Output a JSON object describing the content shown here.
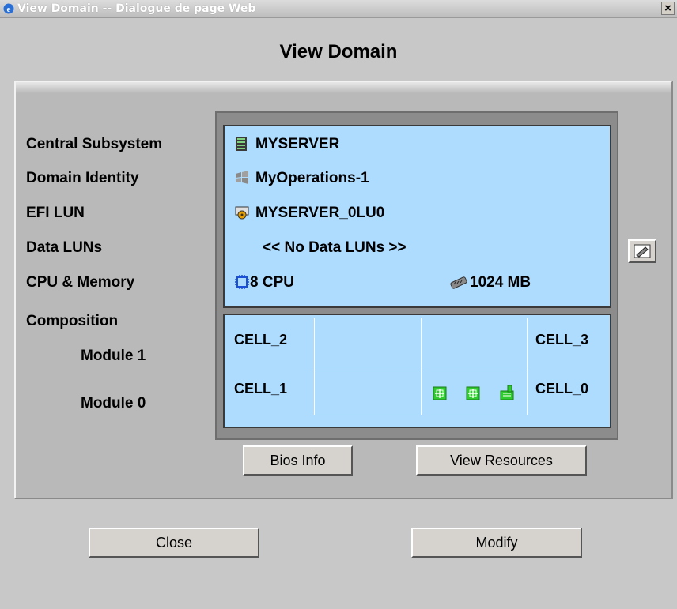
{
  "window": {
    "title": "View Domain -- Dialogue de page Web",
    "close_label": "×"
  },
  "heading": "View Domain",
  "labels": {
    "central_subsystem": "Central Subsystem",
    "domain_identity": "Domain Identity",
    "efi_lun": "EFI LUN",
    "data_luns": "Data LUNs",
    "cpu_memory": "CPU & Memory",
    "composition": "Composition",
    "module1": "Module 1",
    "module0": "Module 0"
  },
  "info": {
    "central_subsystem": "MYSERVER",
    "domain_identity": "MyOperations-1",
    "efi_lun": "MYSERVER_0LU0",
    "data_luns": "<< No Data LUNs >>",
    "cpu": "8 CPU",
    "memory": "1024 MB"
  },
  "cells": {
    "cell2": "CELL_2",
    "cell3": "CELL_3",
    "cell1": "CELL_1",
    "cell0": "CELL_0"
  },
  "buttons": {
    "bios_info": "Bios Info",
    "view_resources": "View Resources",
    "close": "Close",
    "modify": "Modify"
  },
  "colors": {
    "info_background": "#aedcff",
    "dialog_background": "#c8c8c8",
    "module_icon_green": "#2ecc2e"
  }
}
